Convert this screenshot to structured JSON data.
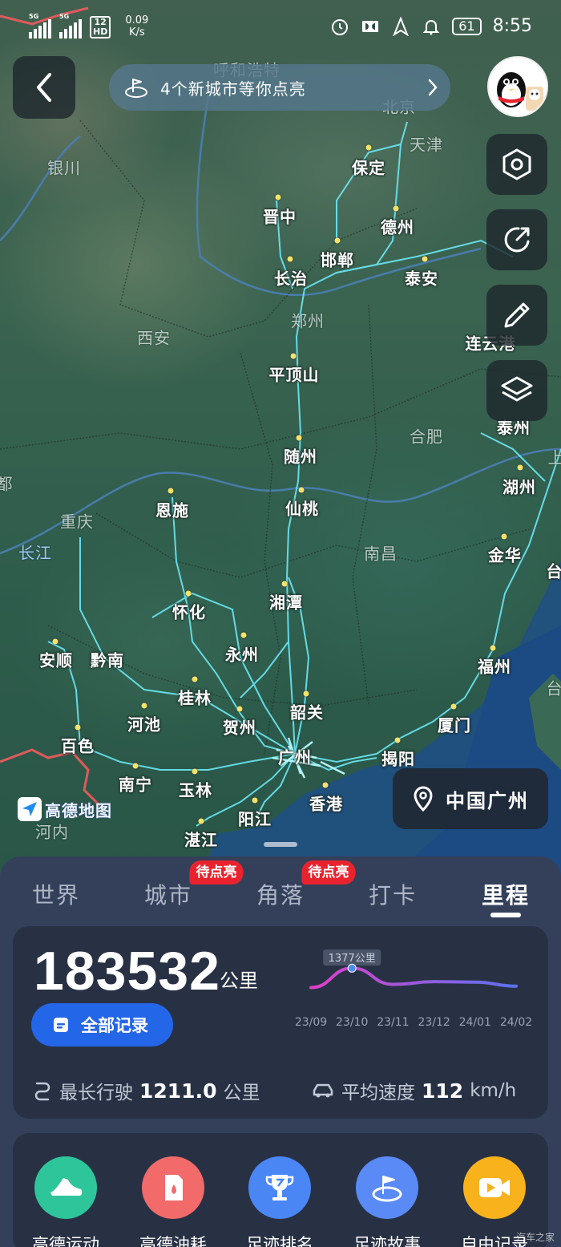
{
  "status_bar": {
    "sim1": "5G",
    "sim2": "5G",
    "hd_top": "12",
    "hd_bottom": "HD",
    "net_speed_value": "0.09",
    "net_speed_unit": "K/s",
    "battery": "61",
    "time": "8:55"
  },
  "map": {
    "banner_text": "4个新城市等你点亮",
    "location_label": "中国广州",
    "provider_logo": "高德地图",
    "labels": {
      "hohhot": "呼和浩特",
      "beijing": "北京",
      "tianjin": "天津",
      "yinchuan": "银川",
      "baoding": "保定",
      "jinzhong": "晋中",
      "dezhou": "德州",
      "handan": "邯郸",
      "changzhi": "长治",
      "taian": "泰安",
      "zhengzhou": "郑州",
      "xian": "西安",
      "lianyungang": "连云港",
      "pingdingshan": "平顶山",
      "taizhou_js": "泰州",
      "hefei": "合肥",
      "shang": "上",
      "suizhou": "随州",
      "huzhou": "湖州",
      "du": "都",
      "chongqing": "重庆",
      "enshi": "恩施",
      "xiantao": "仙桃",
      "changjiang": "长江",
      "nanchang": "南昌",
      "jinhua": "金华",
      "tai": "台",
      "huaihua": "怀化",
      "xiangtan": "湘潭",
      "anshun": "安顺",
      "qiannan": "黔南",
      "yongzhou": "永州",
      "fuzhou": "福州",
      "guilin": "桂林",
      "tai2": "台",
      "hechi": "河池",
      "shaoguan": "韶关",
      "hezhou": "贺州",
      "xiamen": "厦门",
      "baise": "百色",
      "guangzhou": "广州",
      "jieyang": "揭阳",
      "nanning": "南宁",
      "yulin": "玉林",
      "hongkong": "香港",
      "yangjiang": "阳江",
      "henei": "河内",
      "zhanjiang": "湛江"
    }
  },
  "tabs": [
    {
      "label": "世界"
    },
    {
      "label": "城市",
      "badge": "待点亮"
    },
    {
      "label": "角落",
      "badge": "待点亮"
    },
    {
      "label": "打卡"
    },
    {
      "label": "里程",
      "active": true
    }
  ],
  "mileage": {
    "total": "183532",
    "unit": "公里",
    "all_records_label": "全部记录",
    "longest_label": "最长行驶",
    "longest_value": "1211.0",
    "longest_unit": "公里",
    "avg_speed_label": "平均速度",
    "avg_speed_value": "112",
    "avg_speed_unit": "km/h"
  },
  "chart_data": {
    "type": "line",
    "x": [
      "23/09",
      "23/10",
      "23/11",
      "23/12",
      "24/01",
      "24/02"
    ],
    "highlight": {
      "x": "23/10",
      "label": "1377公里",
      "value": 1377
    },
    "values": [
      950,
      1377,
      1020,
      1080,
      1070,
      980
    ],
    "title": "",
    "xlabel": "",
    "ylabel": "",
    "colors": {
      "start": "#e040c8",
      "end": "#5a72f0"
    }
  },
  "tools": [
    {
      "label": "高德运动",
      "icon": "sneaker-icon",
      "color": "#2ec59a"
    },
    {
      "label": "高德油耗",
      "icon": "fuel-can-icon",
      "color": "#f26a6a"
    },
    {
      "label": "足迹排名",
      "icon": "trophy-icon",
      "color": "#4b86f5"
    },
    {
      "label": "足迹故事",
      "icon": "story-flag-icon",
      "color": "#5a8af5"
    },
    {
      "label": "自由记录",
      "icon": "video-record-icon",
      "color": "#f8b21c"
    }
  ],
  "watermark": "汽车之家"
}
